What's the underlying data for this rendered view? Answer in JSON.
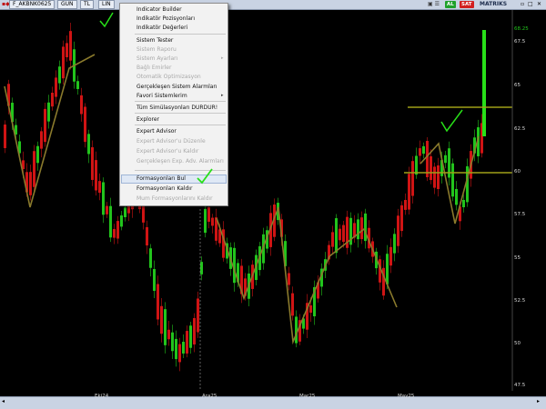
{
  "topbar": {
    "symbol": "F_AKBNK0625",
    "period": "GUN",
    "currency": "TL",
    "type": "LIN",
    "tab_al": "AL",
    "tab_sat": "SAT",
    "brand": "MATRIKS",
    "colors": {
      "al": "#1fa12a",
      "sat": "#d21f1f"
    }
  },
  "menu": {
    "items": [
      {
        "label": "Indicator Builder",
        "enabled": true
      },
      {
        "label": "Indikatör Pozisyonları",
        "enabled": true
      },
      {
        "label": "Indikatör Değerleri",
        "enabled": true
      },
      {
        "label": "Sistem Tester",
        "enabled": true
      },
      {
        "label": "Sistem Raporu",
        "enabled": false
      },
      {
        "label": "Sistem Ayarları",
        "enabled": false,
        "submenu": true
      },
      {
        "label": "Bağlı Emirler",
        "enabled": false
      },
      {
        "label": "Otomatik Optimizasyon",
        "enabled": false
      },
      {
        "label": "Gerçekleşen Sistem Alarmları",
        "enabled": true
      },
      {
        "label": "Favori Sistemlerim",
        "enabled": true,
        "submenu": true
      },
      {
        "label": "Tüm Simülasyonları DURDUR!",
        "enabled": true
      },
      {
        "label": "Explorer",
        "enabled": true
      },
      {
        "label": "Expert Advisor",
        "enabled": true
      },
      {
        "label": "Expert Advisor'u Düzenle",
        "enabled": false
      },
      {
        "label": "Expert Advisor'u Kaldır",
        "enabled": false
      },
      {
        "label": "Gerçekleşen Exp. Adv. Alarmları",
        "enabled": false
      },
      {
        "label": "Formasyonları Bul",
        "enabled": true,
        "highlighted": true
      },
      {
        "label": "Formasyonları Kaldır",
        "enabled": true
      },
      {
        "label": "Mum Formasyonlarını Kaldır",
        "enabled": false
      }
    ]
  },
  "chart_data": {
    "type": "candlestick",
    "y_ticks": [
      "68.25",
      "67.5",
      "65",
      "62.5",
      "60",
      "57.5",
      "55",
      "52.5",
      "50",
      "47.5"
    ],
    "x_ticks": [
      "Eki24",
      "Ara25",
      "Mar25",
      "May25"
    ],
    "current_price": "68.25",
    "horizontal_levels": [
      63.95,
      59.9
    ],
    "colors": {
      "up": "#22c41c",
      "down": "#d01414",
      "pattern": "#8a7a2c",
      "level": "#a0a018",
      "check": "#28e018"
    }
  }
}
